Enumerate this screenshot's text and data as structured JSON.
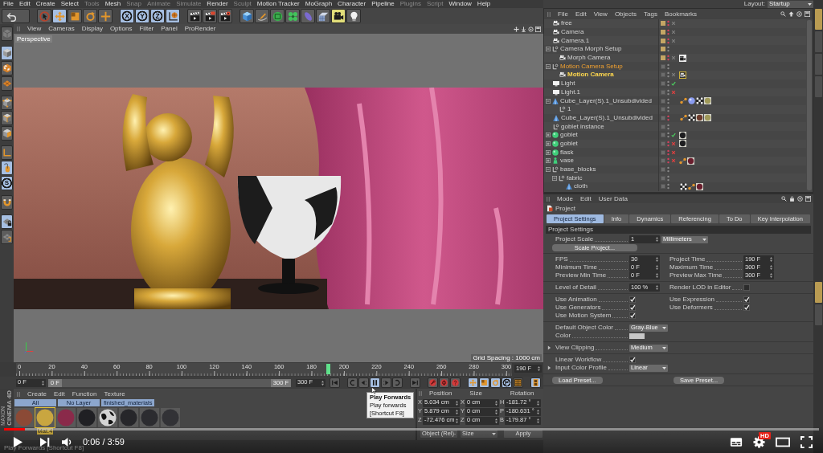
{
  "menubar": {
    "items": [
      {
        "label": "File",
        "disabled": false
      },
      {
        "label": "Edit",
        "disabled": false
      },
      {
        "label": "Create",
        "disabled": false
      },
      {
        "label": "Select",
        "disabled": false
      },
      {
        "label": "Tools",
        "disabled": true
      },
      {
        "label": "Mesh",
        "disabled": false
      },
      {
        "label": "Snap",
        "disabled": true
      },
      {
        "label": "Animate",
        "disabled": true
      },
      {
        "label": "Simulate",
        "disabled": true
      },
      {
        "label": "Render",
        "disabled": false
      },
      {
        "label": "Sculpt",
        "disabled": true
      },
      {
        "label": "Motion Tracker",
        "disabled": false
      },
      {
        "label": "MoGraph",
        "disabled": false
      },
      {
        "label": "Character",
        "disabled": false
      },
      {
        "label": "Pipeline",
        "disabled": false
      },
      {
        "label": "Plugins",
        "disabled": true
      },
      {
        "label": "Script",
        "disabled": true
      },
      {
        "label": "Window",
        "disabled": false
      },
      {
        "label": "Help",
        "disabled": false
      }
    ]
  },
  "toolbar": {
    "groups": [
      [
        {
          "kind": "undo",
          "selected": false
        }
      ],
      [
        {
          "kind": "select",
          "selected": false
        },
        {
          "kind": "move",
          "selected": true
        },
        {
          "kind": "scale",
          "selected": false
        },
        {
          "kind": "rotate",
          "selected": false
        },
        {
          "kind": "recent",
          "selected": false
        }
      ],
      [
        {
          "kind": "axis",
          "label": "X",
          "selected": true
        },
        {
          "kind": "axis",
          "label": "Y",
          "selected": true
        },
        {
          "kind": "axis",
          "label": "Z",
          "selected": true
        },
        {
          "kind": "coords",
          "selected": true
        }
      ],
      [
        {
          "kind": "render-view",
          "selected": false
        },
        {
          "kind": "render-picture",
          "selected": false
        },
        {
          "kind": "render-settings",
          "selected": false
        }
      ],
      [
        {
          "kind": "cube",
          "selected": false
        },
        {
          "kind": "pen",
          "selected": false
        },
        {
          "kind": "subdivision",
          "selected": false
        },
        {
          "kind": "cloner",
          "selected": false
        },
        {
          "kind": "deformer",
          "selected": false
        },
        {
          "kind": "floor",
          "selected": false
        },
        {
          "kind": "camera",
          "selected": false
        },
        {
          "kind": "light",
          "selected": false
        }
      ]
    ]
  },
  "tool_strip": {
    "groups": [
      [
        {
          "kind": "make-editable",
          "selected": false
        }
      ],
      [
        {
          "kind": "model",
          "selected": true
        },
        {
          "kind": "texture",
          "selected": false
        },
        {
          "kind": "workplane",
          "selected": false
        }
      ],
      [
        {
          "kind": "points",
          "selected": false
        },
        {
          "kind": "edges",
          "selected": false
        },
        {
          "kind": "polygons",
          "selected": false
        }
      ],
      [
        {
          "kind": "axis-mode",
          "selected": false
        },
        {
          "kind": "tweak",
          "selected": true
        },
        {
          "kind": "snap",
          "label": "S",
          "selected": true
        }
      ],
      [
        {
          "kind": "magnet",
          "selected": false
        }
      ],
      [
        {
          "kind": "workplane-lock",
          "selected": true
        },
        {
          "kind": "workplane-align",
          "selected": false
        }
      ]
    ]
  },
  "viewport": {
    "menu": [
      "View",
      "Cameras",
      "Display",
      "Options",
      "Filter",
      "Panel",
      "ProRender"
    ],
    "camera": "Perspective",
    "grid": "Grid Spacing : 1000 cm"
  },
  "timeline": {
    "ticks": [
      "0",
      "20",
      "40",
      "60",
      "80",
      "100",
      "120",
      "140",
      "160",
      "180",
      "200",
      "220",
      "240",
      "260",
      "280",
      "300"
    ],
    "level": 0.633,
    "current": "190 F"
  },
  "transport": {
    "start": "0 F",
    "range": {
      "start": "0 F",
      "end": "300 F",
      "level": 1
    },
    "end": "300 F",
    "groups": [
      [
        {
          "kind": "go-start",
          "selected": false
        }
      ],
      [
        {
          "kind": "prev-key",
          "selected": false
        },
        {
          "kind": "prev-frame",
          "selected": false
        },
        {
          "kind": "play",
          "selected": true
        },
        {
          "kind": "next-frame",
          "selected": false
        },
        {
          "kind": "next-key",
          "selected": false
        }
      ],
      [
        {
          "kind": "go-end",
          "selected": false
        }
      ],
      [
        {
          "kind": "record",
          "selected": false
        },
        {
          "kind": "autokey",
          "selected": false
        },
        {
          "kind": "keyset",
          "selected": false
        }
      ],
      [
        {
          "kind": "key-position",
          "selected": true
        },
        {
          "kind": "key-scale",
          "selected": true
        },
        {
          "kind": "key-rotation",
          "selected": true
        },
        {
          "kind": "key-parameter",
          "label": "P",
          "selected": true
        },
        {
          "kind": "key-points",
          "selected": false
        }
      ],
      [
        {
          "kind": "timeline",
          "selected": true
        }
      ]
    ]
  },
  "tooltip": {
    "title": "Play Forwards",
    "lines": [
      "Play forwards",
      "[Shortcut F8]"
    ]
  },
  "material_manager": {
    "menu": [
      "Create",
      "Edit",
      "Function",
      "Texture"
    ],
    "layers": [
      "All",
      "No Layer",
      "finished_materials"
    ],
    "materials": [
      {
        "kind": "plain",
        "color": "#8b4a36",
        "selected": false
      },
      {
        "kind": "plain",
        "color": "#c9a640",
        "selected": true,
        "label": "Mat.4"
      },
      {
        "kind": "plain",
        "color": "#8a2a4a",
        "selected": false
      },
      {
        "kind": "plain",
        "color": "#202024",
        "selected": false
      },
      {
        "kind": "spotted",
        "color": "#d4d4d4",
        "selected": false
      },
      {
        "kind": "plain",
        "color": "#26262a",
        "selected": false
      },
      {
        "kind": "plain",
        "color": "#2c2c30",
        "selected": false
      },
      {
        "kind": "plain",
        "color": "#323236",
        "selected": false
      }
    ]
  },
  "coordinates": {
    "headers": [
      "Position",
      "Size",
      "Rotation"
    ],
    "rows": [
      {
        "axes": [
          "X",
          "X",
          "H"
        ],
        "values": [
          "5.034 cm",
          "0 cm",
          "-181.72 °"
        ]
      },
      {
        "axes": [
          "Y",
          "Y",
          "P"
        ],
        "values": [
          "5.879 cm",
          "0 cm",
          "-180.631 °"
        ]
      },
      {
        "axes": [
          "Z",
          "Z",
          "B"
        ],
        "values": [
          "-72.476 cm",
          "0 cm",
          "-179.87 °"
        ]
      }
    ],
    "mode": "Object (Rel)",
    "size_mode": "Size",
    "apply": "Apply"
  },
  "branding": [
    "MAXON",
    "CINEMA 4D"
  ],
  "status_bar": "Play Forwards [Shortcut F8]",
  "layout": {
    "label": "Layout:",
    "value": "Startup"
  },
  "object_manager": {
    "menu": [
      "File",
      "Edit",
      "View",
      "Objects",
      "Tags",
      "Bookmarks"
    ],
    "objects": [
      {
        "name": "free",
        "kind": "camera",
        "selected": false,
        "active": false,
        "visible": false,
        "color": "#c4a564"
      },
      {
        "name": "Camera",
        "kind": "camera",
        "selected": false,
        "active": false,
        "visible": false,
        "color": "#c4a564"
      },
      {
        "name": "Camera.1",
        "kind": "camera",
        "selected": false,
        "active": false,
        "visible": false,
        "color": "#c4a564"
      },
      {
        "name": "Camera Morph Setup",
        "kind": "null",
        "expanded": true,
        "selected": false,
        "active": false,
        "visible": true,
        "color": "#c4a564",
        "children": [
          {
            "name": "Morph Camera",
            "kind": "camera",
            "selected": false,
            "active": false,
            "visible": false,
            "color": "#c4a564",
            "tags": [
              {
                "kind": "morph"
              }
            ]
          }
        ]
      },
      {
        "name": "Motion Camera Setup",
        "kind": "null",
        "expanded": true,
        "selected": true,
        "active": false,
        "visible": true,
        "children": [
          {
            "name": "Motion Camera",
            "kind": "camera",
            "selected": true,
            "active": true,
            "visible": true,
            "tags": [
              {
                "kind": "motion"
              }
            ]
          }
        ]
      },
      {
        "name": "Light",
        "kind": "light",
        "selected": false,
        "active": false,
        "visible": true,
        "enabled": true
      },
      {
        "name": "Light.1",
        "kind": "light",
        "selected": false,
        "active": false,
        "visible": true,
        "enabled": false
      },
      {
        "name": "Cube_Layer(S).1_Unsubdivided",
        "kind": "polygon",
        "expanded": true,
        "selected": false,
        "active": false,
        "visible": true,
        "tags": [
          {
            "kind": "phong"
          },
          {
            "kind": "display"
          },
          {
            "kind": "uvw"
          },
          {
            "kind": "material",
            "color": "#a09a5a"
          }
        ],
        "children": [
          {
            "name": "1",
            "kind": "null",
            "selected": false,
            "active": false,
            "visible": true
          }
        ]
      },
      {
        "name": "Cube_Layer(S).1_Unsubdivided",
        "kind": "polygon",
        "selected": false,
        "active": false,
        "visible": false,
        "tags": [
          {
            "kind": "phong"
          },
          {
            "kind": "uvw"
          },
          {
            "kind": "material",
            "color": "#6b3a2c"
          },
          {
            "kind": "material",
            "color": "#a09a5a"
          }
        ]
      },
      {
        "name": "goblet instance",
        "kind": "null",
        "selected": false,
        "active": false,
        "visible": true
      },
      {
        "name": "goblet",
        "kind": "generator",
        "expanded": false,
        "selected": false,
        "active": false,
        "visible": true,
        "enabled": true,
        "tags": [
          {
            "kind": "material",
            "color": "#1e1e20"
          }
        ]
      },
      {
        "name": "goblet",
        "kind": "generator",
        "expanded": false,
        "selected": false,
        "active": false,
        "visible": false,
        "enabled": false,
        "tags": [
          {
            "kind": "material",
            "color": "#1e1e20"
          }
        ]
      },
      {
        "name": "flask",
        "kind": "generator",
        "expanded": false,
        "selected": false,
        "active": false,
        "visible": false,
        "enabled": false
      },
      {
        "name": "vase",
        "kind": "figure",
        "expanded": false,
        "selected": false,
        "active": false,
        "visible": false,
        "enabled": false,
        "tags": [
          {
            "kind": "phong"
          },
          {
            "kind": "material",
            "color": "#6a1e2e"
          }
        ]
      },
      {
        "name": "base_blocks",
        "kind": "null",
        "expanded": true,
        "selected": false,
        "active": false,
        "visible": true,
        "children": [
          {
            "name": "fabric",
            "kind": "null",
            "expanded": true,
            "selected": false,
            "active": false,
            "visible": true,
            "children": [
              {
                "name": "cloth",
                "kind": "polygon",
                "selected": false,
                "active": false,
                "visible": true,
                "tags": [
                  {
                    "kind": "uvw"
                  },
                  {
                    "kind": "phong"
                  },
                  {
                    "kind": "material",
                    "color": "#6a1e2e"
                  }
                ]
              }
            ]
          }
        ]
      }
    ]
  },
  "side_tabs": {
    "groups": [
      [
        {
          "selected": true
        },
        {
          "selected": false
        },
        {
          "selected": false
        },
        {
          "selected": false
        }
      ],
      [
        {
          "selected": true
        },
        {
          "selected": false
        }
      ]
    ]
  },
  "attributes": {
    "menu": [
      "Mode",
      "Edit",
      "User Data"
    ],
    "title": "Project",
    "tabs": [
      {
        "label": "Project Settings",
        "selected": true
      },
      {
        "label": "Info",
        "selected": false
      },
      {
        "label": "Dynamics",
        "selected": false
      },
      {
        "label": "Referencing",
        "selected": false
      },
      {
        "label": "To Do",
        "selected": false
      },
      {
        "label": "Key Interpolation",
        "selected": false
      }
    ],
    "section": "Project Settings",
    "groups": [
      {
        "rows": [
          [
            {
              "kind": "number",
              "label": "Project Scale",
              "value": "1"
            },
            {
              "kind": "dropdown",
              "value": "Millimeters"
            }
          ],
          [
            {
              "kind": "button",
              "label": "Scale Project..."
            }
          ]
        ]
      },
      {
        "rows": [
          [
            {
              "kind": "number",
              "label": "FPS",
              "value": "30"
            },
            {
              "kind": "number",
              "label": "Project Time",
              "value": "190 F"
            }
          ],
          [
            {
              "kind": "number",
              "label": "Minimum Time",
              "value": "0 F"
            },
            {
              "kind": "number",
              "label": "Maximum Time",
              "value": "300 F"
            }
          ],
          [
            {
              "kind": "number",
              "label": "Preview Min Time",
              "value": "0 F"
            },
            {
              "kind": "number",
              "label": "Preview Max Time",
              "value": "300 F"
            }
          ]
        ]
      },
      {
        "rows": [
          [
            {
              "kind": "number",
              "label": "Level of Detail",
              "value": "100 %"
            },
            {
              "kind": "check",
              "label": "Render LOD in Editor",
              "checked": false
            }
          ]
        ]
      },
      {
        "rows": [
          [
            {
              "kind": "check",
              "label": "Use Animation",
              "checked": true
            },
            {
              "kind": "check",
              "label": "Use Expression",
              "checked": true
            }
          ],
          [
            {
              "kind": "check",
              "label": "Use Generators",
              "checked": true
            },
            {
              "kind": "check",
              "label": "Use Deformers",
              "checked": true
            }
          ],
          [
            {
              "kind": "check",
              "label": "Use Motion System",
              "checked": true
            }
          ]
        ]
      },
      {
        "rows": [
          [
            {
              "kind": "dropdown",
              "label": "Default Object Color",
              "value": "Gray-Blue"
            }
          ],
          [
            {
              "kind": "swatch",
              "label": "Color",
              "color": "#c8c8c8"
            }
          ]
        ]
      },
      {
        "rows": [
          [
            {
              "kind": "dropdown",
              "label": "View Clipping",
              "value": "Medium",
              "expanded": false
            }
          ]
        ]
      },
      {
        "rows": [
          [
            {
              "kind": "check",
              "label": "Linear Workflow",
              "checked": true
            }
          ],
          [
            {
              "kind": "dropdown",
              "label": "Input Color Profile",
              "value": "Linear",
              "expanded": false
            }
          ]
        ]
      },
      {
        "rows": [
          [
            {
              "kind": "button",
              "label": "Load Preset..."
            },
            {
              "kind": "button",
              "label": "Save Preset..."
            }
          ]
        ]
      }
    ]
  },
  "player": {
    "level": 0.026,
    "time": "0:06 / 3:59",
    "badge": "HD"
  }
}
